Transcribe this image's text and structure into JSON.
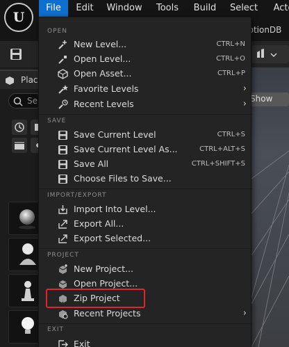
{
  "menubar": {
    "items": [
      {
        "label": "File",
        "active": true
      },
      {
        "label": "Edit"
      },
      {
        "label": "Window"
      },
      {
        "label": "Tools"
      },
      {
        "label": "Build"
      },
      {
        "label": "Select"
      },
      {
        "label": "Acto"
      }
    ],
    "logo": "U"
  },
  "project_name": "notionDB",
  "left_panel": {
    "tab_label": "Plac",
    "search_placeholder": "Se"
  },
  "viewport": {
    "show_label": "Show"
  },
  "file_menu": {
    "sections": {
      "open": "OPEN",
      "save": "SAVE",
      "import_export": "IMPORT/EXPORT",
      "project": "PROJECT",
      "exit": "EXIT"
    },
    "items": {
      "new_level": {
        "label": "New Level...",
        "shortcut": "CTRL+N",
        "icon": "new-level-icon"
      },
      "open_level": {
        "label": "Open Level...",
        "shortcut": "CTRL+O",
        "icon": "open-level-icon"
      },
      "open_asset": {
        "label": "Open Asset...",
        "shortcut": "CTRL+P",
        "icon": "open-asset-icon"
      },
      "favorite_levels": {
        "label": "Favorite Levels",
        "icon": "favorite-levels-icon"
      },
      "recent_levels": {
        "label": "Recent Levels",
        "icon": "recent-levels-icon"
      },
      "save_current_level": {
        "label": "Save Current Level",
        "shortcut": "CTRL+S",
        "icon": "save-icon"
      },
      "save_current_level_as": {
        "label": "Save Current Level As...",
        "shortcut": "CTRL+ALT+S",
        "icon": "save-as-icon"
      },
      "save_all": {
        "label": "Save All",
        "shortcut": "CTRL+SHIFT+S",
        "icon": "save-all-icon"
      },
      "choose_files": {
        "label": "Choose Files to Save...",
        "icon": "choose-files-icon"
      },
      "import_into_level": {
        "label": "Import Into Level...",
        "icon": "import-icon"
      },
      "export_all": {
        "label": "Export All...",
        "icon": "export-all-icon"
      },
      "export_selected": {
        "label": "Export Selected...",
        "icon": "export-selected-icon"
      },
      "new_project": {
        "label": "New Project...",
        "icon": "new-project-icon"
      },
      "open_project": {
        "label": "Open Project...",
        "icon": "open-project-icon"
      },
      "zip_project": {
        "label": "Zip Project",
        "icon": "zip-project-icon"
      },
      "recent_projects": {
        "label": "Recent Projects",
        "icon": "recent-projects-icon"
      },
      "exit": {
        "label": "Exit",
        "icon": "exit-icon"
      }
    },
    "submenu_arrow": "›"
  },
  "colors": {
    "accent": "#0e6fd1",
    "menu_bg": "#242424",
    "highlight": "#e3242b"
  }
}
